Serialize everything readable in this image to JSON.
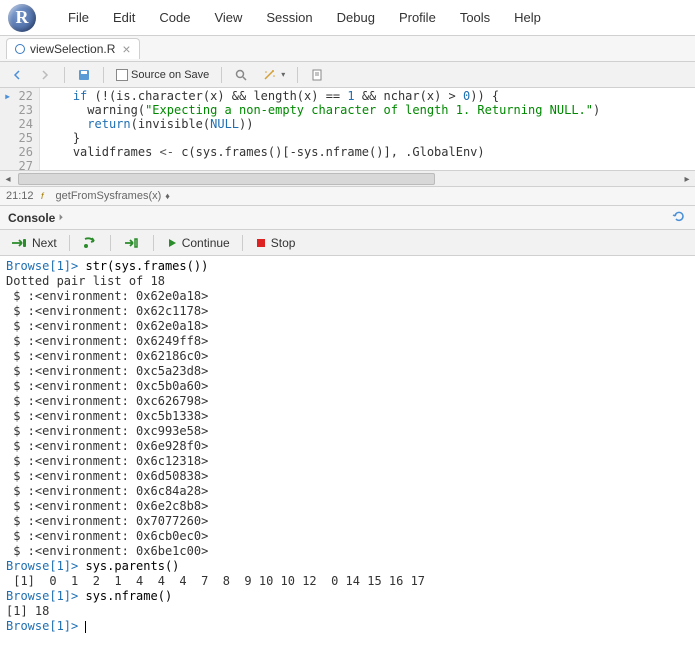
{
  "menubar": {
    "items": [
      "File",
      "Edit",
      "Code",
      "View",
      "Session",
      "Debug",
      "Profile",
      "Tools",
      "Help"
    ]
  },
  "tab": {
    "name": "viewSelection.R"
  },
  "editor_toolbar": {
    "source_on_save": "Source on Save"
  },
  "editor": {
    "lines": [
      {
        "num": "22",
        "breakpoint": true,
        "code_html": "    <span class='kw'>if</span> (!(is.character(x) && length(x) == <span class='num'>1</span> && nchar(x) > <span class='num'>0</span>)) {"
      },
      {
        "num": "23",
        "breakpoint": false,
        "code_html": "      warning(<span class='str'>\"Expecting a non-empty character of length 1. Returning NULL.\"</span>)"
      },
      {
        "num": "24",
        "breakpoint": false,
        "code_html": "      <span class='kw'>return</span>(invisible(<span class='num'>NULL</span>))"
      },
      {
        "num": "25",
        "breakpoint": false,
        "code_html": "    }"
      },
      {
        "num": "26",
        "breakpoint": false,
        "code_html": "    validframes <span class='op'>&lt;-</span> c(sys.frames()[-sys.nframe()], .GlobalEnv)"
      },
      {
        "num": "27",
        "breakpoint": false,
        "code_html": ""
      }
    ]
  },
  "statusbar": {
    "position": "21:12",
    "fn": "getFromSysframes(x)"
  },
  "console": {
    "title": "Console",
    "toolbar": {
      "next": "Next",
      "continue": "Continue",
      "stop": "Stop"
    },
    "lines": [
      {
        "type": "prompt",
        "text": "Browse[1]> ",
        "input": "str(sys.frames())"
      },
      {
        "type": "out",
        "text": "Dotted pair list of 18"
      },
      {
        "type": "out",
        "text": " $ :<environment: 0x62e0a18>"
      },
      {
        "type": "out",
        "text": " $ :<environment: 0x62c1178>"
      },
      {
        "type": "out",
        "text": " $ :<environment: 0x62e0a18>"
      },
      {
        "type": "out",
        "text": " $ :<environment: 0x6249ff8>"
      },
      {
        "type": "out",
        "text": " $ :<environment: 0x62186c0>"
      },
      {
        "type": "out",
        "text": " $ :<environment: 0xc5a23d8>"
      },
      {
        "type": "out",
        "text": " $ :<environment: 0xc5b0a60>"
      },
      {
        "type": "out",
        "text": " $ :<environment: 0xc626798>"
      },
      {
        "type": "out",
        "text": " $ :<environment: 0xc5b1338>"
      },
      {
        "type": "out",
        "text": " $ :<environment: 0xc993e58>"
      },
      {
        "type": "out",
        "text": " $ :<environment: 0x6e928f0>"
      },
      {
        "type": "out",
        "text": " $ :<environment: 0x6c12318>"
      },
      {
        "type": "out",
        "text": " $ :<environment: 0x6d50838>"
      },
      {
        "type": "out",
        "text": " $ :<environment: 0x6c84a28>"
      },
      {
        "type": "out",
        "text": " $ :<environment: 0x6e2c8b8>"
      },
      {
        "type": "out",
        "text": " $ :<environment: 0x7077260>"
      },
      {
        "type": "out",
        "text": " $ :<environment: 0x6cb0ec0>"
      },
      {
        "type": "out",
        "text": " $ :<environment: 0x6be1c00>"
      },
      {
        "type": "prompt",
        "text": "Browse[1]> ",
        "input": "sys.parents()"
      },
      {
        "type": "out",
        "text": " [1]  0  1  2  1  4  4  4  7  8  9 10 10 12  0 14 15 16 17"
      },
      {
        "type": "prompt",
        "text": "Browse[1]> ",
        "input": "sys.nframe()"
      },
      {
        "type": "out",
        "text": "[1] 18"
      },
      {
        "type": "prompt",
        "text": "Browse[1]> ",
        "input": "",
        "cursor": true
      }
    ]
  }
}
